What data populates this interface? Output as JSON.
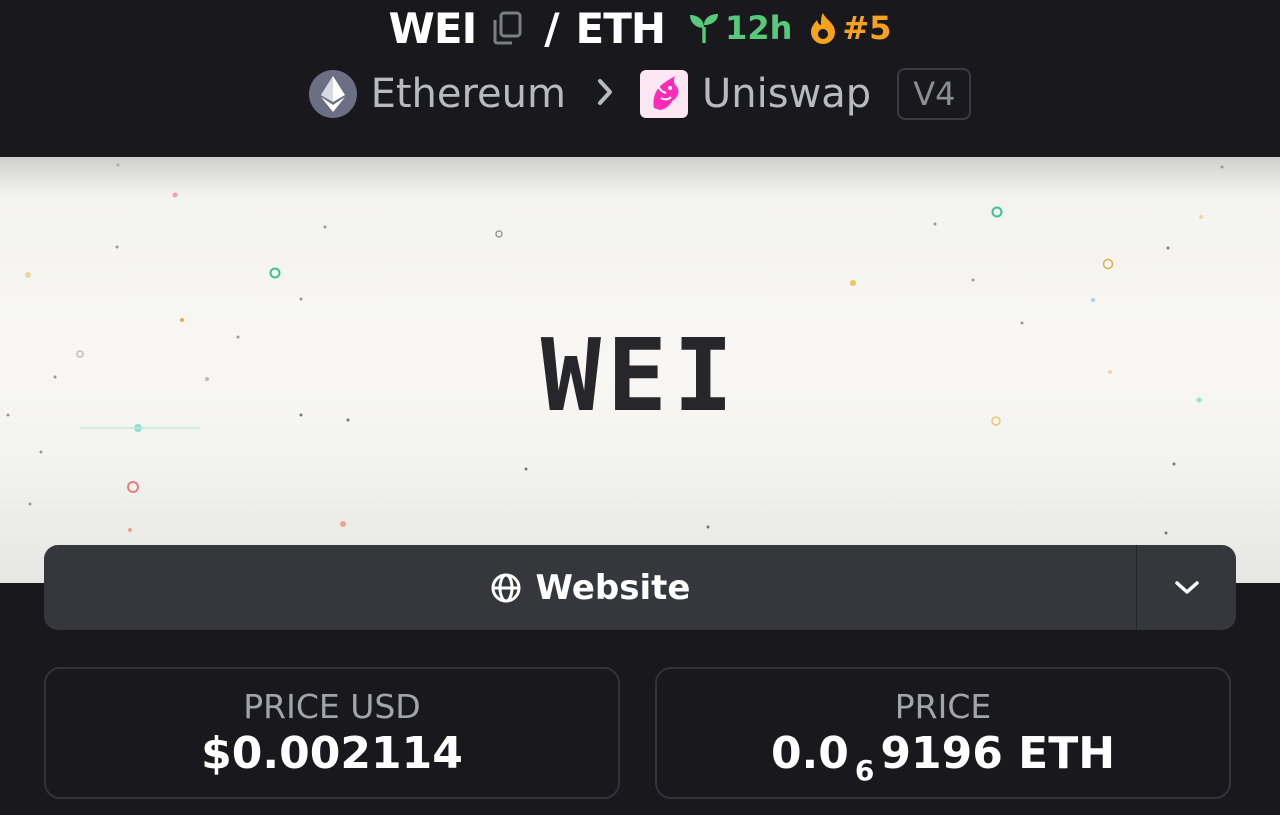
{
  "header": {
    "base_symbol": "WEI",
    "separator": "/",
    "quote_symbol": "ETH",
    "age": "12h",
    "rank": "#5",
    "chain": "Ethereum",
    "dex": "Uniswap",
    "version": "V4"
  },
  "banner": {
    "text": "WEI"
  },
  "links": {
    "website_label": "Website"
  },
  "stats": {
    "price_usd_label": "PRICE USD",
    "price_usd_value": "$0.002114",
    "price_label": "PRICE",
    "price_value_prefix": "0.0",
    "price_value_zeros": "6",
    "price_value_rest": "9196 ETH"
  },
  "colors": {
    "age_green": "#57c97a",
    "rank_orange": "#f7a21e",
    "card_bg": "#36363d",
    "page_bg": "#18181d"
  },
  "icons": [
    "copy-icon",
    "seedling-icon",
    "fire-icon",
    "ethereum-logo",
    "chevron-right-icon",
    "uniswap-logo",
    "globe-icon",
    "chevron-down-icon"
  ]
}
